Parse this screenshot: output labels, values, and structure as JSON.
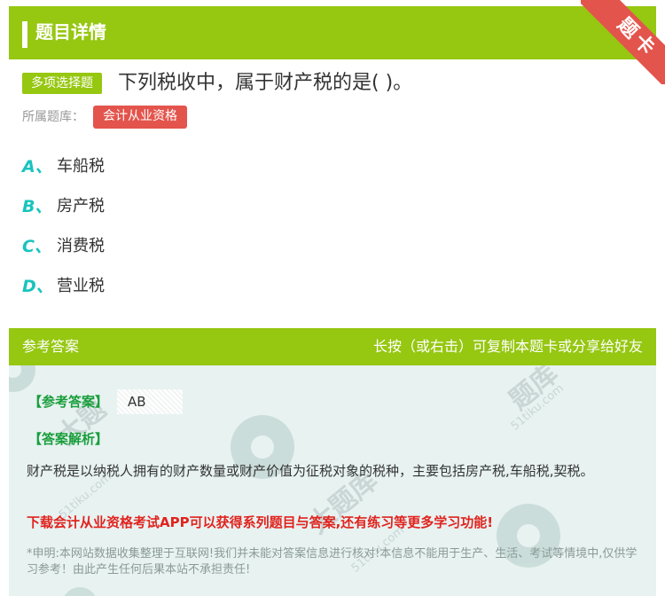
{
  "header": {
    "title": "题目详情",
    "ribbon": "题卡"
  },
  "question": {
    "type": "多项选择题",
    "text": "下列税收中，属于财产税的是( )。",
    "bank_label": "所属题库：",
    "bank": "会计从业资格"
  },
  "options": [
    {
      "letter": "A、",
      "text": "车船税"
    },
    {
      "letter": "B、",
      "text": "房产税"
    },
    {
      "letter": "C、",
      "text": "消费税"
    },
    {
      "letter": "D、",
      "text": "营业税"
    }
  ],
  "answer": {
    "header_left": "参考答案",
    "header_right": "长按（或右击）可复制本题卡或分享给好友",
    "ref_label": "【参考答案】",
    "ref_value": "AB",
    "exp_label": "【答案解析】",
    "explanation": "财产税是以纳税人拥有的财产数量或财产价值为征税对象的税种，主要包括房产税,车船税,契税。",
    "promo": "下载会计从业资格考试APP可以获得系列题目与答案,还有练习等更多学习功能!",
    "disclaimer": "*申明:本网站数据收集整理于互联网!我们并未能对答案信息进行核对!本信息不能用于生产、生活、考试等情境中,仅供学习参考！由此产生任何后果本站不承担责任!"
  },
  "colors": {
    "green": "#96c711",
    "red": "#e3544c",
    "teal": "#19c3be",
    "panel": "#e7f2f1"
  }
}
